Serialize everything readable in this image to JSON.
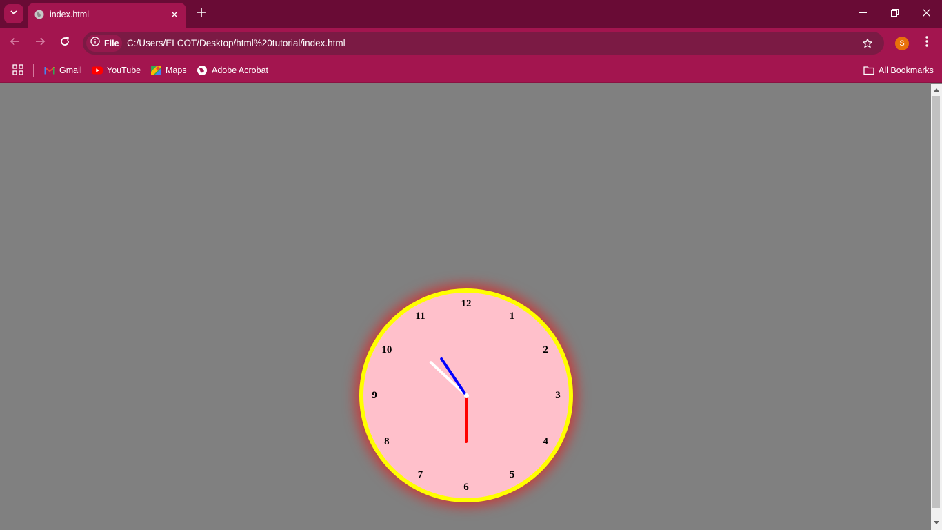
{
  "browser": {
    "tab": {
      "title": "index.html"
    },
    "address_bar": {
      "scheme_chip": "File",
      "url": "C:/Users/ELCOT/Desktop/html%20tutorial/index.html"
    },
    "profile_initial": "S",
    "bookmarks": [
      {
        "label": "Gmail",
        "icon": "gmail-icon"
      },
      {
        "label": "YouTube",
        "icon": "youtube-icon"
      },
      {
        "label": "Maps",
        "icon": "maps-icon"
      },
      {
        "label": "Adobe Acrobat",
        "icon": "globe-icon"
      }
    ],
    "all_bookmarks_label": "All Bookmarks",
    "colors": {
      "frame": "#690b35",
      "toolbar": "#a3154f",
      "omnibox": "#7b1a44"
    }
  },
  "clock": {
    "numbers": [
      "12",
      "1",
      "2",
      "3",
      "4",
      "5",
      "6",
      "7",
      "8",
      "9",
      "10",
      "11"
    ],
    "colors": {
      "face": "#ffc0cb",
      "border": "#ffff00",
      "glow": "#ff0000",
      "hour_hand": "#0000ff",
      "minute_hand": "#ffffff",
      "second_hand": "#ff0000",
      "page_background": "#808080"
    }
  }
}
